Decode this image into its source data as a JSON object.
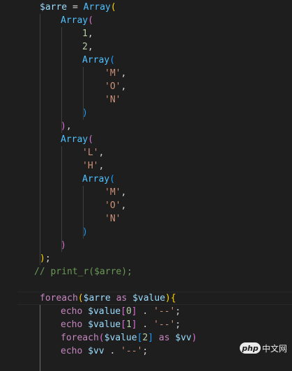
{
  "editor": {
    "language": "php",
    "lines": [
      [
        {
          "t": "$arre",
          "c": "var"
        },
        {
          "t": " = ",
          "c": "plain"
        },
        {
          "t": "Array",
          "c": "fn"
        },
        {
          "t": "(",
          "c": "b1"
        }
      ],
      [
        {
          "t": "Array",
          "c": "fn"
        },
        {
          "t": "(",
          "c": "b2"
        }
      ],
      [
        {
          "t": "1",
          "c": "num"
        },
        {
          "t": ",",
          "c": "plain"
        }
      ],
      [
        {
          "t": "2",
          "c": "num"
        },
        {
          "t": ",",
          "c": "plain"
        }
      ],
      [
        {
          "t": "Array",
          "c": "fn"
        },
        {
          "t": "(",
          "c": "b3"
        }
      ],
      [
        {
          "t": "'M'",
          "c": "str"
        },
        {
          "t": ",",
          "c": "plain"
        }
      ],
      [
        {
          "t": "'O'",
          "c": "str"
        },
        {
          "t": ",",
          "c": "plain"
        }
      ],
      [
        {
          "t": "'N'",
          "c": "str"
        }
      ],
      [
        {
          "t": ")",
          "c": "b3"
        }
      ],
      [
        {
          "t": ")",
          "c": "b2"
        },
        {
          "t": ",",
          "c": "plain"
        }
      ],
      [
        {
          "t": "Array",
          "c": "fn"
        },
        {
          "t": "(",
          "c": "b2"
        }
      ],
      [
        {
          "t": "'L'",
          "c": "str"
        },
        {
          "t": ",",
          "c": "plain"
        }
      ],
      [
        {
          "t": "'H'",
          "c": "str"
        },
        {
          "t": ",",
          "c": "plain"
        }
      ],
      [
        {
          "t": "Array",
          "c": "fn"
        },
        {
          "t": "(",
          "c": "b3"
        }
      ],
      [
        {
          "t": "'M'",
          "c": "str"
        },
        {
          "t": ",",
          "c": "plain"
        }
      ],
      [
        {
          "t": "'O'",
          "c": "str"
        },
        {
          "t": ",",
          "c": "plain"
        }
      ],
      [
        {
          "t": "'N'",
          "c": "str"
        }
      ],
      [
        {
          "t": ")",
          "c": "b3"
        }
      ],
      [
        {
          "t": ")",
          "c": "b2"
        }
      ],
      [
        {
          "t": ")",
          "c": "b1"
        },
        {
          "t": ";",
          "c": "plain"
        }
      ],
      [
        {
          "t": "// print_r($arre);",
          "c": "cmt"
        }
      ],
      [],
      [
        {
          "t": "foreach",
          "c": "kw"
        },
        {
          "t": "(",
          "c": "b1"
        },
        {
          "t": "$arre",
          "c": "var"
        },
        {
          "t": " as ",
          "c": "kw"
        },
        {
          "t": "$value",
          "c": "var"
        },
        {
          "t": ")",
          "c": "b1"
        },
        {
          "t": "{",
          "c": "b1"
        }
      ],
      [
        {
          "t": "echo ",
          "c": "kw"
        },
        {
          "t": "$value",
          "c": "var"
        },
        {
          "t": "[",
          "c": "b2"
        },
        {
          "t": "0",
          "c": "num"
        },
        {
          "t": "]",
          "c": "b2"
        },
        {
          "t": " . ",
          "c": "plain"
        },
        {
          "t": "'--'",
          "c": "str"
        },
        {
          "t": ";",
          "c": "plain"
        }
      ],
      [
        {
          "t": "echo ",
          "c": "kw"
        },
        {
          "t": "$value",
          "c": "var"
        },
        {
          "t": "[",
          "c": "b2"
        },
        {
          "t": "1",
          "c": "num"
        },
        {
          "t": "]",
          "c": "b2"
        },
        {
          "t": " . ",
          "c": "plain"
        },
        {
          "t": "'--'",
          "c": "str"
        },
        {
          "t": ";",
          "c": "plain"
        }
      ],
      [
        {
          "t": "foreach",
          "c": "kw"
        },
        {
          "t": "(",
          "c": "b2"
        },
        {
          "t": "$value",
          "c": "var"
        },
        {
          "t": "[",
          "c": "b3"
        },
        {
          "t": "2",
          "c": "num"
        },
        {
          "t": "]",
          "c": "b3"
        },
        {
          "t": " as ",
          "c": "kw"
        },
        {
          "t": "$vv",
          "c": "var"
        },
        {
          "t": ")",
          "c": "b2"
        }
      ],
      [
        {
          "t": "echo ",
          "c": "kw"
        },
        {
          "t": "$vv",
          "c": "var"
        },
        {
          "t": " . ",
          "c": "plain"
        },
        {
          "t": "'--'",
          "c": "str"
        },
        {
          "t": ";",
          "c": "plain"
        }
      ]
    ]
  },
  "watermark": {
    "logo_text": "php",
    "site_text": "中文网"
  }
}
